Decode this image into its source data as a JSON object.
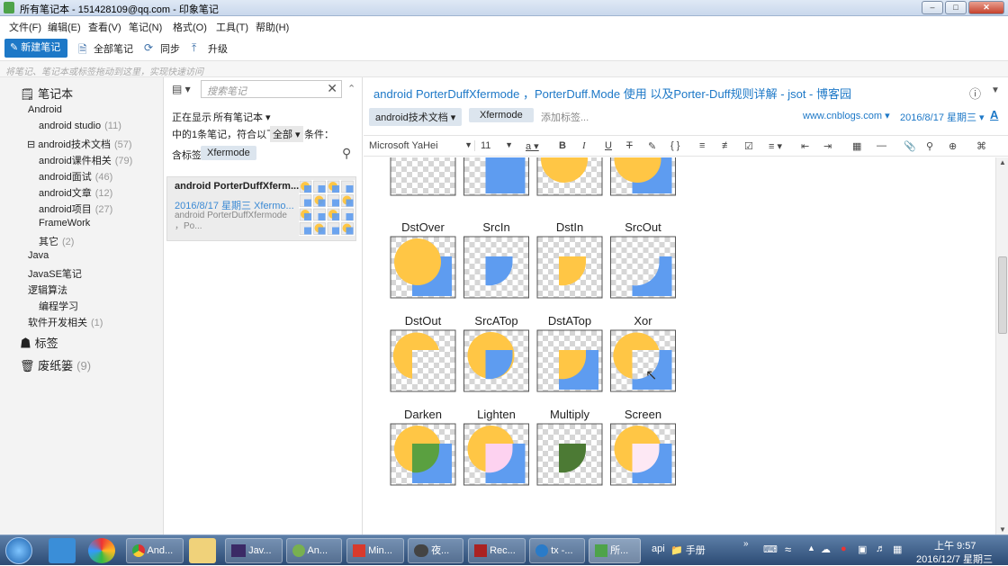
{
  "window": {
    "title": "所有笔记本 - 151428109@qq.com - 印象笔记"
  },
  "menu": [
    "文件(F)",
    "编辑(E)",
    "查看(V)",
    "笔记(N)",
    "格式(O)",
    "工具(T)",
    "帮助(H)"
  ],
  "toolbar": {
    "new_note": "新建笔记",
    "all_notes": "全部笔记",
    "sync": "同步",
    "upgrade": "升级"
  },
  "tip": "将笔记、笔记本或标签拖动到这里，实现快速访问",
  "sidebar": {
    "notebooks_label": "笔记本",
    "items": [
      {
        "label": "Android",
        "count": ""
      },
      {
        "label": "android studio",
        "count": "(11)"
      },
      {
        "label": "android技术文档",
        "count": "(57)"
      },
      {
        "label": "android课件相关",
        "count": "(79)"
      },
      {
        "label": "android面试",
        "count": "(46)"
      },
      {
        "label": "android文章",
        "count": "(12)"
      },
      {
        "label": "android项目",
        "count": "(27)"
      },
      {
        "label": "FrameWork",
        "count": ""
      },
      {
        "label": "其它",
        "count": "(2)"
      },
      {
        "label": "Java",
        "count": ""
      },
      {
        "label": "JavaSE笔记",
        "count": ""
      },
      {
        "label": "逻辑算法",
        "count": ""
      },
      {
        "label": "编程学习",
        "count": ""
      },
      {
        "label": "软件开发相关",
        "count": "(1)"
      }
    ],
    "tags_label": "标签",
    "trash_label": "废纸篓",
    "trash_count": "(9)"
  },
  "list": {
    "search_placeholder": "搜索笔记",
    "showing": "正在显示",
    "scope": "所有笔记本",
    "matching": "中的1条笔记，符合以下",
    "all": "全部",
    "conditions": "条件：",
    "contains_tag": "含标签",
    "tag": "Xfermode",
    "card": {
      "title": "android PorterDuffXferm...",
      "date": "2016/8/17 星期三  Xfermo...",
      "snippet": "android PorterDuffXfermode ，Po..."
    }
  },
  "note": {
    "title": "android PorterDuffXfermode ，PorterDuff.Mode 使用 以及Porter-Duff规则详解 - jsot - 博客园",
    "notebook": "android技术文档",
    "tag": "Xfermode",
    "add_tag": "添加标签...",
    "source": "www.cnblogs.com",
    "date": "2016/8/17 星期三",
    "font": "Microsoft YaHei",
    "size": "11"
  },
  "chart_data": {
    "type": "table",
    "title": "",
    "labels_row1": [
      "DstOver",
      "SrcIn",
      "DstIn",
      "SrcOut"
    ],
    "labels_row2": [
      "DstOut",
      "SrcATop",
      "DstATop",
      "Xor"
    ],
    "labels_row3": [
      "Darken",
      "Lighten",
      "Multiply",
      "Screen"
    ],
    "colors": {
      "dst": "#ffc645",
      "src": "#5e9cf0",
      "darken": "#5aa040",
      "lighten": "#fdd2f0",
      "multiply": "#4c7a34",
      "screen": "#fde8f4"
    }
  },
  "taskbar": {
    "items": [
      "And...",
      "Jav...",
      "An...",
      "Min...",
      "夜...",
      "Rec...",
      "tx -...",
      "所..."
    ],
    "tray": {
      "api": "api",
      "folder": "手册",
      "time": "上午 9:57",
      "date": "2016/12/7 星期三"
    }
  }
}
